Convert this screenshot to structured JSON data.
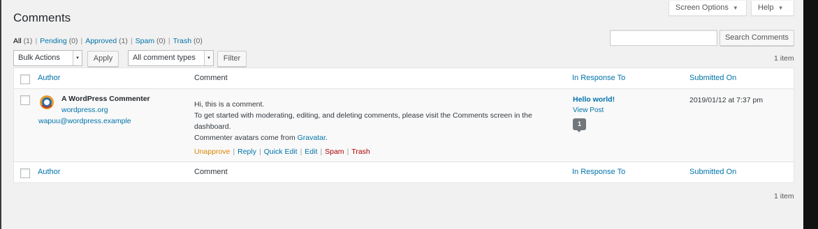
{
  "colors": {
    "background": "#f1f1f1",
    "link": "#0073aa",
    "unapprove": "#d98500",
    "spam_trash": "#a00",
    "bubble": "#72777c"
  },
  "header": {
    "screen_options_label": "Screen Options",
    "help_label": "Help",
    "caret_icon": "▼",
    "title": "Comments"
  },
  "filters": {
    "all_label": "All",
    "all_count": "(1)",
    "pending_label": "Pending",
    "pending_count": "(0)",
    "approved_label": "Approved",
    "approved_count": "(1)",
    "spam_label": "Spam",
    "spam_count": "(0)",
    "trash_label": "Trash",
    "trash_count": "(0)",
    "separator": "|"
  },
  "search": {
    "value": "",
    "button_label": "Search Comments"
  },
  "toolbar": {
    "bulk_actions_selected": "Bulk Actions",
    "apply_label": "Apply",
    "comment_types_selected": "All comment types",
    "filter_label": "Filter",
    "select_arrow_icon": "▾",
    "items_count": "1 item"
  },
  "table": {
    "columns": {
      "author": "Author",
      "comment": "Comment",
      "in_response_to": "In Response To",
      "submitted_on": "Submitted On"
    },
    "rows": [
      {
        "author_name": "A WordPress Commenter",
        "author_url": "wordpress.org",
        "author_email": "wapuu@wordpress.example",
        "comment_line1": "Hi, this is a comment.",
        "comment_line2": "To get started with moderating, editing, and deleting comments, please visit the Comments screen in the dashboard.",
        "comment_line3_prefix": "Commenter avatars come from ",
        "comment_line3_link": "Gravatar",
        "comment_line3_suffix": ".",
        "actions": {
          "unapprove": "Unapprove",
          "reply": "Reply",
          "quick_edit": "Quick Edit",
          "edit": "Edit",
          "spam": "Spam",
          "trash": "Trash"
        },
        "response_title": "Hello world!",
        "view_post_label": "View Post",
        "comment_count": "1",
        "submitted_on": "2019/01/12 at 7:37 pm"
      }
    ]
  },
  "footer": {
    "items_count": "1 item"
  }
}
